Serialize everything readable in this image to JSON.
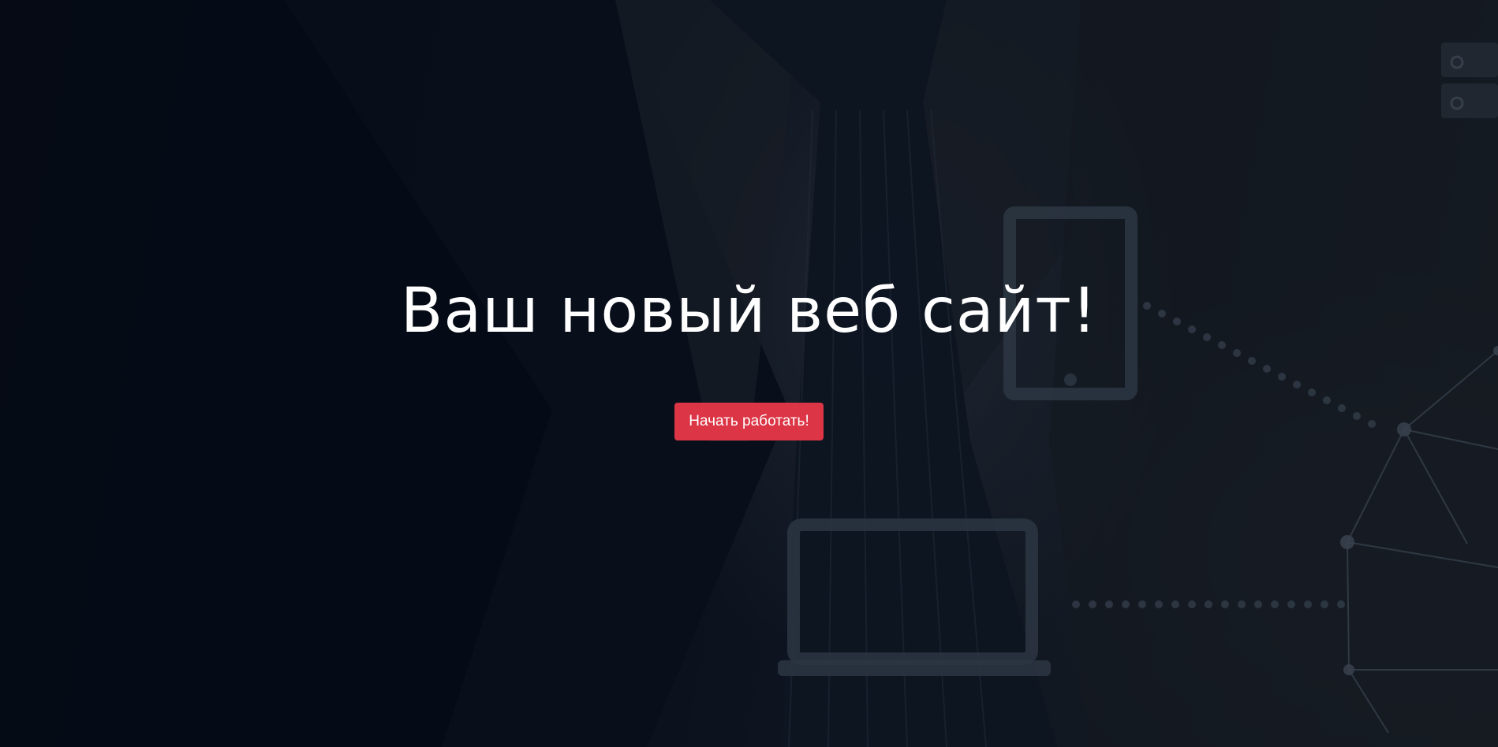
{
  "hero": {
    "title": "Ваш новый веб сайт!",
    "cta_label": "Начать работать!",
    "background_image": "dark business suit with tie and glowing tech device icons"
  },
  "colors": {
    "background": "#0b111c",
    "title": "#ffffff",
    "cta_background": "#dc3545",
    "cta_text": "#ffffff"
  }
}
